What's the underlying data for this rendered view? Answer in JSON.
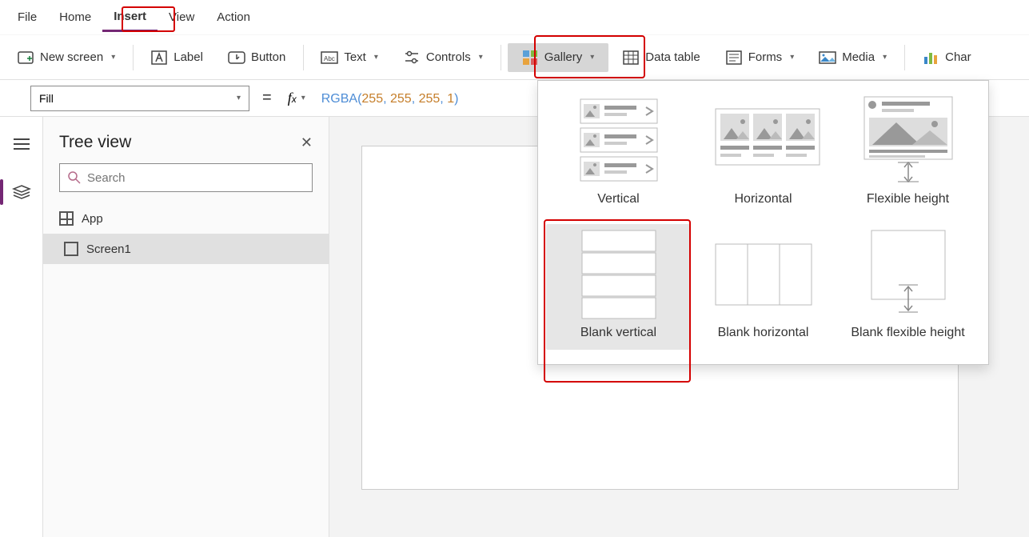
{
  "menu": {
    "items": [
      "File",
      "Home",
      "Insert",
      "View",
      "Action"
    ],
    "active_index": 2
  },
  "toolbar": {
    "new_screen": "New screen",
    "label": "Label",
    "button": "Button",
    "text": "Text",
    "controls": "Controls",
    "gallery": "Gallery",
    "data_table": "Data table",
    "forms": "Forms",
    "media": "Media",
    "char": "Char"
  },
  "formula": {
    "property": "Fill",
    "fn": "RGBA",
    "args": [
      "255",
      "255",
      "255",
      "1"
    ]
  },
  "panel": {
    "title": "Tree view",
    "search_placeholder": "Search",
    "items": [
      {
        "label": "App",
        "selected": false
      },
      {
        "label": "Screen1",
        "selected": true
      }
    ]
  },
  "gallery_dropdown": {
    "options": [
      {
        "label": "Vertical"
      },
      {
        "label": "Horizontal"
      },
      {
        "label": "Flexible height"
      },
      {
        "label": "Blank vertical",
        "selected": true
      },
      {
        "label": "Blank horizontal"
      },
      {
        "label": "Blank flexible height"
      }
    ]
  }
}
